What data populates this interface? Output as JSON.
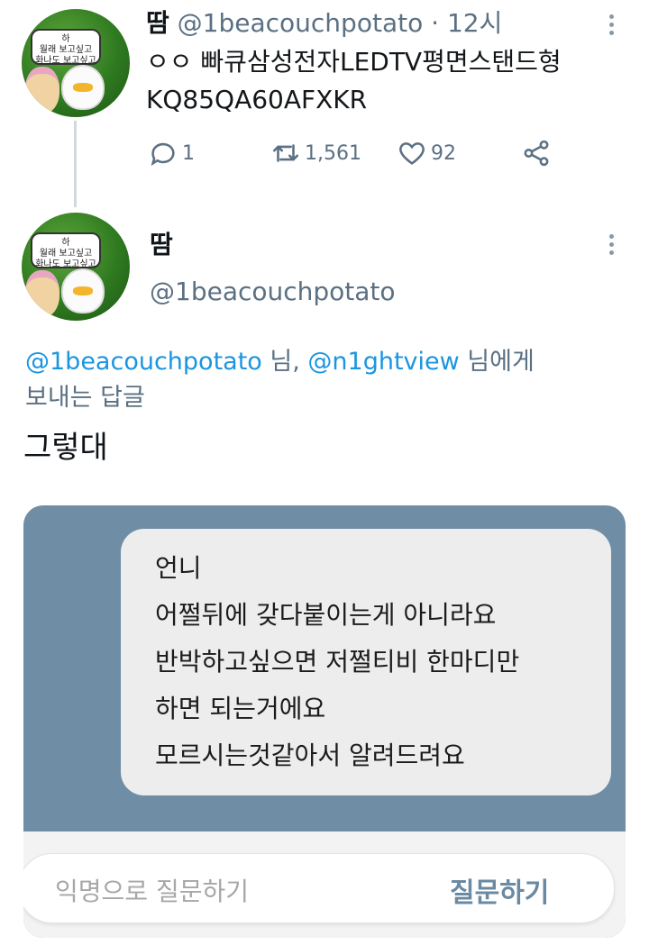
{
  "tweet1": {
    "display_name": "땀",
    "handle": "@1beacouchpotato",
    "separator": "·",
    "time": "12시",
    "text_line1": "ㅇㅇ 빠큐삼성전자LEDTV평면스탠드형",
    "text_line2": "KQ85QA60AFXKR",
    "replies": "1",
    "retweets": "1,561",
    "likes": "92"
  },
  "tweet2": {
    "display_name": "땀",
    "handle": "@1beacouchpotato",
    "reply_to_user1": "@1beacouchpotato",
    "reply_to_mid": " 님, ",
    "reply_to_user2": "@n1ghtview",
    "reply_to_suffix": " 님에게",
    "reply_to_line2": "보내는 답글",
    "text": "그렇대"
  },
  "avatar": {
    "bubble_line1": "하",
    "bubble_line2": "월래 보고싶고",
    "bubble_line3": "화나도 보고싶고"
  },
  "question_card": {
    "lines": [
      "언니",
      "어쩔뒤에 갖다붙이는게 아니라요",
      "반박하고싶으면 저쩔티비 한마디만",
      "하면 되는거에요",
      "모르시는것같아서 알려드려요"
    ],
    "input_placeholder": "익명으로 질문하기",
    "submit_label": "질문하기"
  },
  "icons": {
    "reply": "speech-bubble-icon",
    "retweet": "retweet-arrows-icon",
    "like": "heart-icon",
    "share": "share-nodes-icon",
    "more": "vertical-dots-icon"
  },
  "colors": {
    "link": "#1b95e0",
    "card_bg": "#6f8ea6",
    "muted": "#5b7083"
  }
}
